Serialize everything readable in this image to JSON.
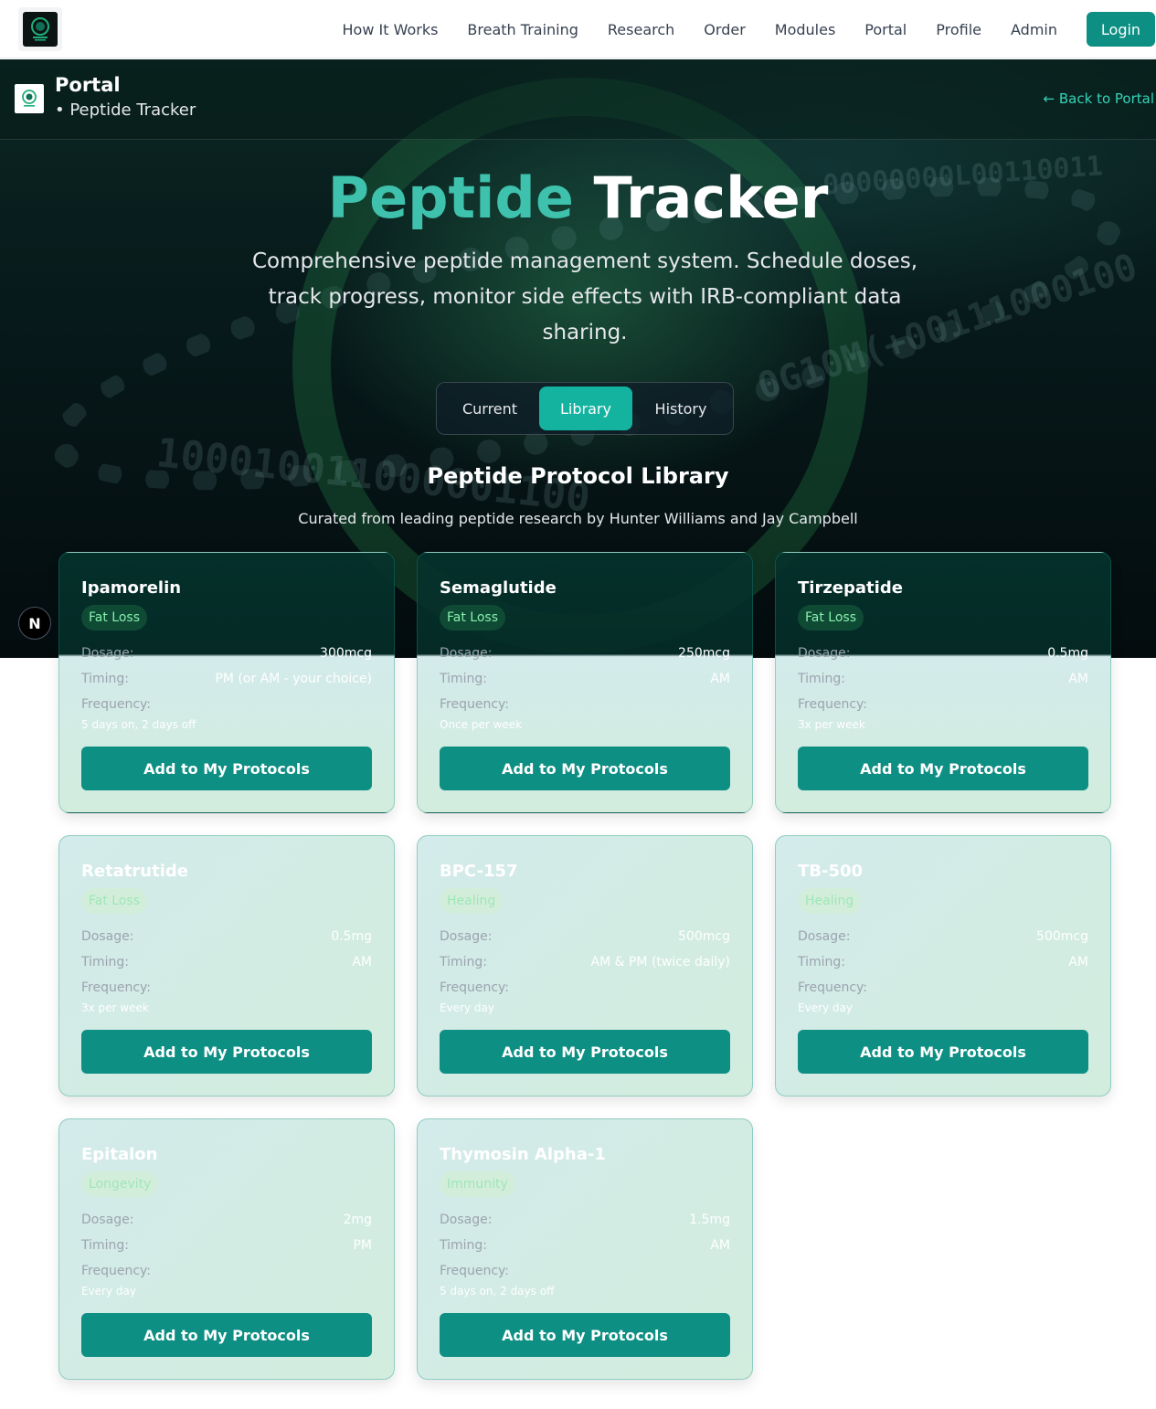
{
  "nav": {
    "links": [
      "How It Works",
      "Breath Training",
      "Research",
      "Order",
      "Modules",
      "Portal",
      "Profile",
      "Admin"
    ],
    "login": "Login"
  },
  "portal_bar": {
    "title": "Portal",
    "subtitle": "• Peptide Tracker",
    "back": "← Back to Portal"
  },
  "hero": {
    "title_accent": "Peptide",
    "title_main": "Tracker",
    "description": "Comprehensive peptide management system. Schedule doses, track progress, monitor side effects with IRB-compliant data sharing.",
    "binary_text_1": "00000000L00110011",
    "binary_text_2": "100010011000001100",
    "binary_text_3": "0G10M(+00111000100"
  },
  "tabs": [
    "Current",
    "Library",
    "History"
  ],
  "active_tab": "Library",
  "library": {
    "title": "Peptide Protocol Library",
    "subtitle": "Curated from leading peptide research by Hunter Williams and Jay Campbell"
  },
  "labels": {
    "dosage": "Dosage:",
    "timing": "Timing:",
    "frequency": "Frequency:",
    "add_button": "Add to My Protocols"
  },
  "cards": [
    {
      "name": "Ipamorelin",
      "category": "Fat Loss",
      "dosage": "300mcg",
      "timing": "PM (or AM - your choice)",
      "frequency": "5 days on, 2 days off"
    },
    {
      "name": "Semaglutide",
      "category": "Fat Loss",
      "dosage": "250mcg",
      "timing": "AM",
      "frequency": "Once per week"
    },
    {
      "name": "Tirzepatide",
      "category": "Fat Loss",
      "dosage": "0.5mg",
      "timing": "AM",
      "frequency": "3x per week"
    },
    {
      "name": "Retatrutide",
      "category": "Fat Loss",
      "dosage": "0.5mg",
      "timing": "AM",
      "frequency": "3x per week"
    },
    {
      "name": "BPC-157",
      "category": "Healing",
      "dosage": "500mcg",
      "timing": "AM & PM (twice daily)",
      "frequency": "Every day"
    },
    {
      "name": "TB-500",
      "category": "Healing",
      "dosage": "500mcg",
      "timing": "AM",
      "frequency": "Every day"
    },
    {
      "name": "Epitalon",
      "category": "Longevity",
      "dosage": "2mg",
      "timing": "PM",
      "frequency": "Every day"
    },
    {
      "name": "Thymosin Alpha-1",
      "category": "Immunity",
      "dosage": "1.5mg",
      "timing": "AM",
      "frequency": "5 days on, 2 days off"
    }
  ],
  "floating_badge": "N",
  "colors": {
    "primary": "#0e8f84",
    "accent": "#3ec1ad",
    "active_tab": "#14b3a0",
    "back_link": "#34d3b8"
  },
  "icons": {
    "logo": "dna-logo-icon",
    "portal_logo": "dna-logo-icon"
  }
}
